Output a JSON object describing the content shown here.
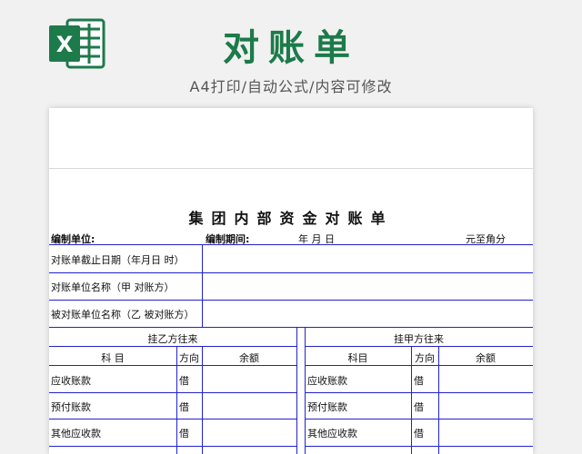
{
  "header": {
    "title": "对账单",
    "subtitle": "A4打印/自动公式/内容可修改",
    "logo_letter": "X"
  },
  "document": {
    "title": "集团内部资金对账单",
    "unit_label": "编制单位:",
    "period_label": "编制期间:",
    "date_label": "年 月 日",
    "currency_label": "元至角分"
  },
  "info_rows": [
    "对账单截止日期（年月日 时）",
    "对账单位名称（甲 对账方）",
    "被对账单位名称（乙 被对账方）"
  ],
  "left_section": {
    "title": "挂乙方往来",
    "headers": [
      "科 目",
      "方向",
      "余额"
    ],
    "rows": [
      {
        "subject": "应收账款",
        "direction": "借",
        "amount": ""
      },
      {
        "subject": "预付账款",
        "direction": "借",
        "amount": ""
      },
      {
        "subject": "其他应收款",
        "direction": "借",
        "amount": ""
      }
    ]
  },
  "right_section": {
    "title": "挂甲方往来",
    "headers": [
      "科目",
      "方向",
      "余额"
    ],
    "rows": [
      {
        "subject": "应收账款",
        "direction": "借",
        "amount": ""
      },
      {
        "subject": "预付账款",
        "direction": "借",
        "amount": ""
      },
      {
        "subject": "其他应收款",
        "direction": "借",
        "amount": ""
      }
    ]
  },
  "colors": {
    "brand_green": "#1d7a4a",
    "grid_blue": "#2222cc"
  }
}
